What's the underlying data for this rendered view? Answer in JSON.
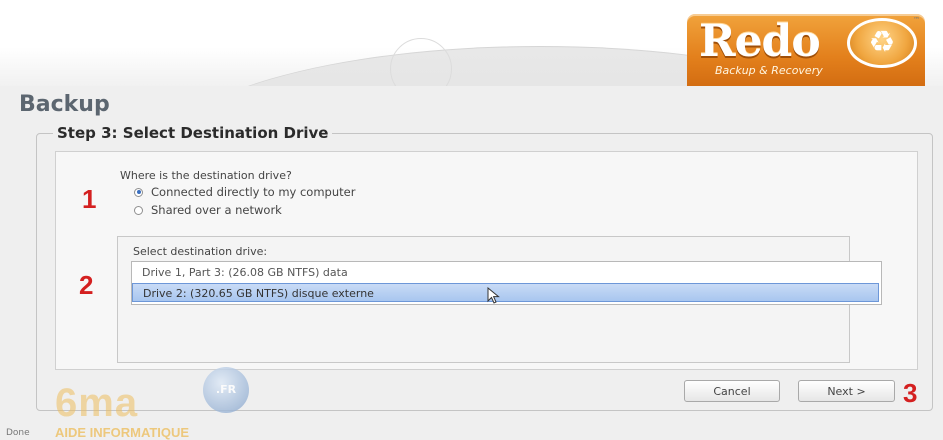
{
  "logo": {
    "name": "Redo",
    "tagline": "Backup & Recovery",
    "trademark": "™",
    "icon": "recycle-icon"
  },
  "page": {
    "title": "Backup"
  },
  "step": {
    "title": "Step 3: Select Destination Drive"
  },
  "location": {
    "question": "Where is the destination drive?",
    "options": [
      {
        "label": "Connected directly to my computer",
        "selected": true
      },
      {
        "label": "Shared over a network",
        "selected": false
      }
    ]
  },
  "drives": {
    "label": "Select destination drive:",
    "items": [
      {
        "label": "Drive 1, Part 3: (26.08 GB NTFS) data",
        "selected": false
      },
      {
        "label": "Drive 2: (320.65 GB NTFS) disque externe",
        "selected": true
      }
    ]
  },
  "annotations": {
    "one": "1",
    "two": "2",
    "three": "3"
  },
  "buttons": {
    "cancel": "Cancel",
    "next": "Next >"
  },
  "watermark": {
    "brand": "6ma",
    "sub": "AIDE INFORMATIQUE",
    "badge": ".FR"
  },
  "status": {
    "text": "Done"
  },
  "colors": {
    "accent": "#e3801c",
    "annotation": "#d42020",
    "selection": "#a8c6ef"
  }
}
